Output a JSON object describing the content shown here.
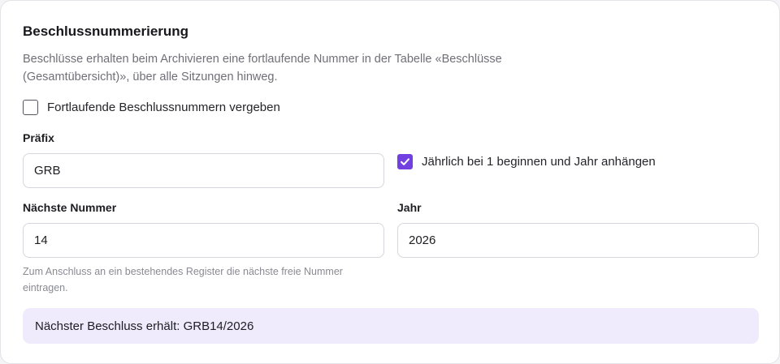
{
  "section": {
    "title": "Beschlussnummerierung",
    "description": "Beschlüsse erhalten beim Archivieren eine fortlaufende Nummer in der Tabelle «Beschlüsse (Gesamtübersicht)», über alle Sitzungen hinweg."
  },
  "options": {
    "continuous_numbers": {
      "label": "Fortlaufende Beschlussnummern vergeben",
      "checked": false
    },
    "yearly_reset": {
      "label": "Jährlich bei 1 beginnen und Jahr anhängen",
      "checked": true
    }
  },
  "fields": {
    "prefix": {
      "label": "Präfix",
      "value": "GRB"
    },
    "next_number": {
      "label": "Nächste Nummer",
      "value": "14",
      "hint": "Zum Anschluss an ein bestehendes Register die nächste freie Nummer eintragen."
    },
    "year": {
      "label": "Jahr",
      "value": "2026"
    }
  },
  "preview": {
    "text": "Nächster Beschluss erhält: GRB14/2026"
  },
  "colors": {
    "accent": "#7240e0",
    "preview_bg": "#efebfc"
  }
}
